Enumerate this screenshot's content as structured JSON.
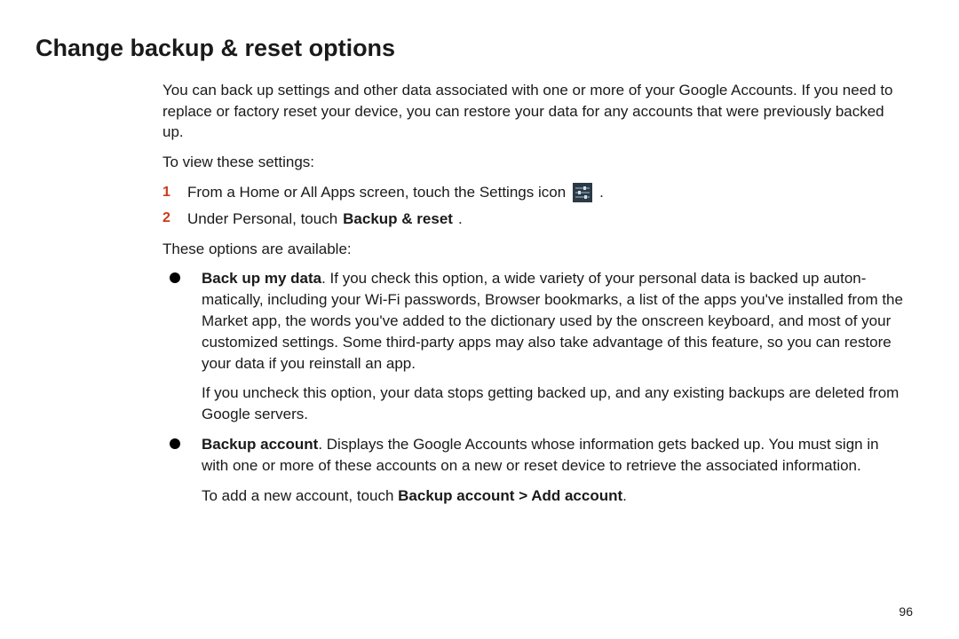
{
  "title": "Change backup & reset options",
  "intro": "You can back up settings and other data associated with one or more of your Google Accounts. If you need to replace or factory reset your device, you can restore your data for any accounts that were previously backed up.",
  "instructions_header": "To view these settings:",
  "steps": [
    {
      "num": "1",
      "pre_text": "From a Home or All Apps screen, touch the Settings icon ",
      "post_text": " ."
    },
    {
      "num": "2",
      "pre_text": "Under Personal, touch ",
      "bold": "Backup & reset",
      "post_text": "."
    }
  ],
  "options_header": "These options are available:",
  "bullets": [
    {
      "bold_lead": "Back up my data",
      "text1": ". If you check this option, a wide variety of your personal data is backed up auton-matically, including your Wi-Fi passwords, Browser bookmarks, a list of the apps you've installed from the Market app, the words you've added to the dictionary used by the onscreen keyboard, and most of your customized settings. Some third-party apps may also take advantage of this feature, so you can restore your data if you reinstall an app.",
      "text2": "If you uncheck this option, your data stops getting backed up, and any existing backups are deleted from Google servers."
    },
    {
      "bold_lead": "Backup account",
      "text1": ". Displays the Google Accounts whose information gets backed up. You must sign in with one or more of these accounts on a new or reset device to retrieve the associated information.",
      "text2_pre": "To add a new account, touch ",
      "text2_bold": "Backup account > Add account",
      "text2_post": "."
    }
  ],
  "page_number": "96"
}
